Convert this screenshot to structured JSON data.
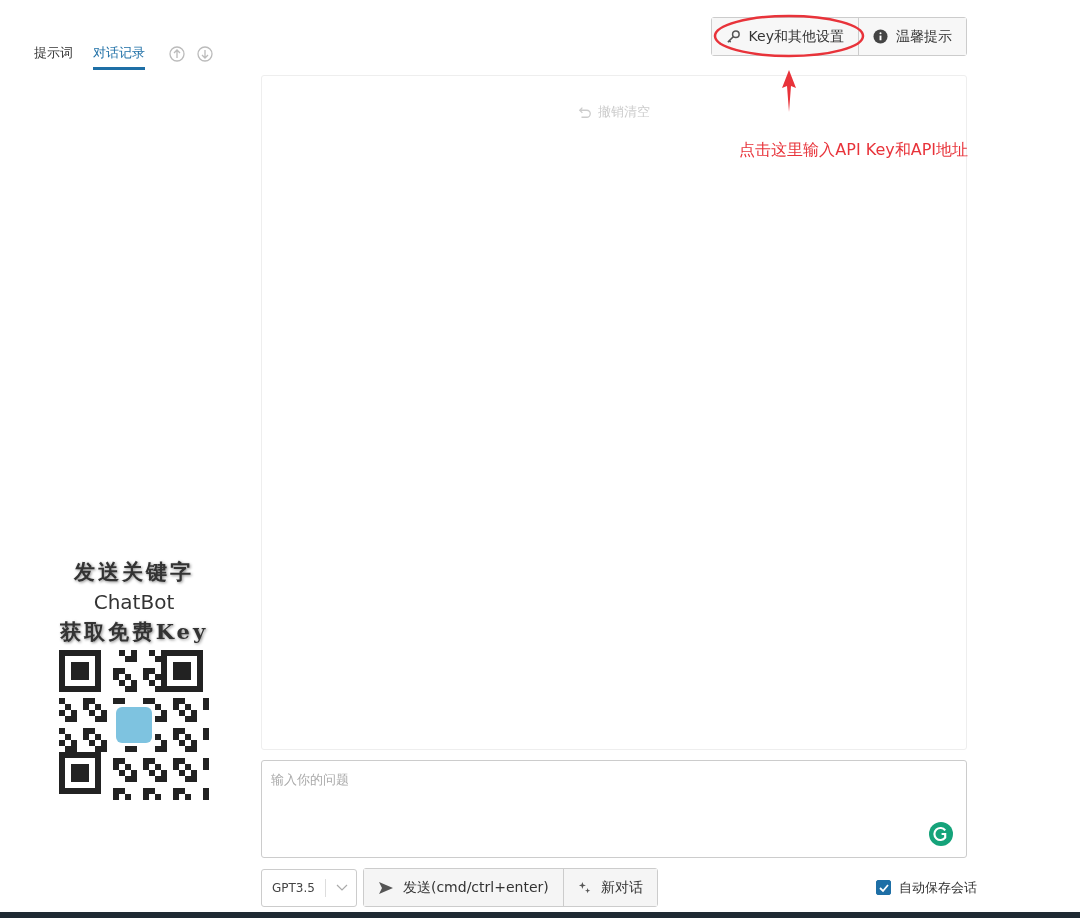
{
  "sidebar": {
    "tabs": [
      {
        "label": "提示词",
        "selected": false
      },
      {
        "label": "对话记录",
        "selected": true
      }
    ],
    "promo": {
      "lines": [
        "发送关键字",
        "ChatBot",
        "获取免费Key"
      ]
    }
  },
  "toolbar": {
    "buttons": [
      {
        "label": "Key和其他设置",
        "kind": "key",
        "highlighted": true
      },
      {
        "label": "温馨提示",
        "kind": "info",
        "highlighted": false
      }
    ]
  },
  "annotation": {
    "text": "点击这里输入API Key和API地址"
  },
  "chat": {
    "undo_label": "撤销清空"
  },
  "input": {
    "placeholder": "输入你的问题"
  },
  "footer": {
    "model": "GPT3.5",
    "send_label": "发送(cmd/ctrl+enter)",
    "new_chat_label": "新对话",
    "autosave": {
      "label": "自动保存会话",
      "checked": true
    }
  }
}
